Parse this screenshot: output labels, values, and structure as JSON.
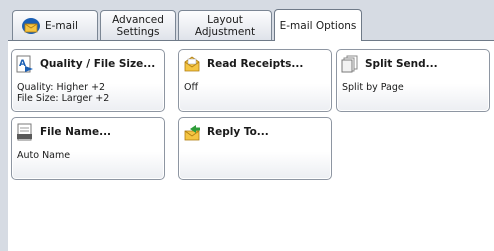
{
  "tabs": [
    {
      "label": "E-mail",
      "icon": "email-icon"
    },
    {
      "label": "Advanced\nSettings"
    },
    {
      "label": "Layout\nAdjustment"
    },
    {
      "label": "E-mail Options",
      "active": true
    }
  ],
  "buttons": {
    "quality": {
      "title": "Quality / File Size...",
      "value": "Quality: Higher +2\nFile Size: Larger +2",
      "icon": "quality-filesize-icon"
    },
    "read_receipts": {
      "title": "Read Receipts...",
      "value": "Off",
      "icon": "read-receipts-icon"
    },
    "split_send": {
      "title": "Split Send...",
      "value": "Split by Page",
      "icon": "split-send-icon"
    },
    "file_name": {
      "title": "File Name...",
      "value": "Auto Name",
      "icon": "file-name-icon"
    },
    "reply_to": {
      "title": "Reply To...",
      "value": "",
      "icon": "reply-to-icon"
    }
  },
  "colors": {
    "accent": "#1a5fb4",
    "envelope": "#f2b632",
    "background": "#d6dbe3"
  }
}
